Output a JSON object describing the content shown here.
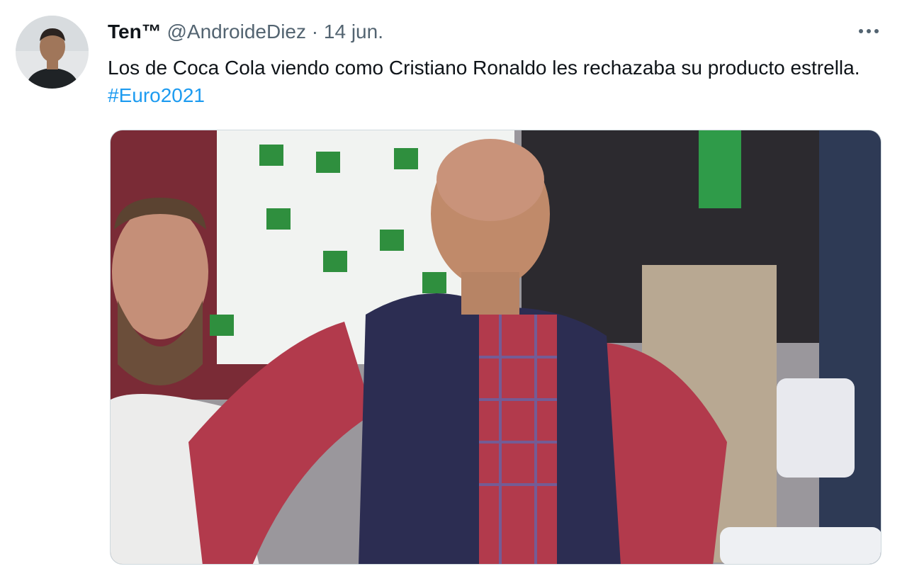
{
  "tweet": {
    "author": {
      "display_name": "Ten™",
      "handle": "@AndroideDiez",
      "separator": "·",
      "date": "14 jun."
    },
    "text_main": "Los de Coca Cola viendo como Cristiano Ronaldo les rechazaba su producto estrella.",
    "hashtag": "#Euro2021",
    "more_icon": "more-horizontal-icon",
    "media": {
      "description_icon": "photo",
      "alt": "Disappointed fan photo"
    }
  },
  "colors": {
    "text": "#0f1419",
    "secondary": "#536471",
    "link": "#1d9bf0"
  }
}
